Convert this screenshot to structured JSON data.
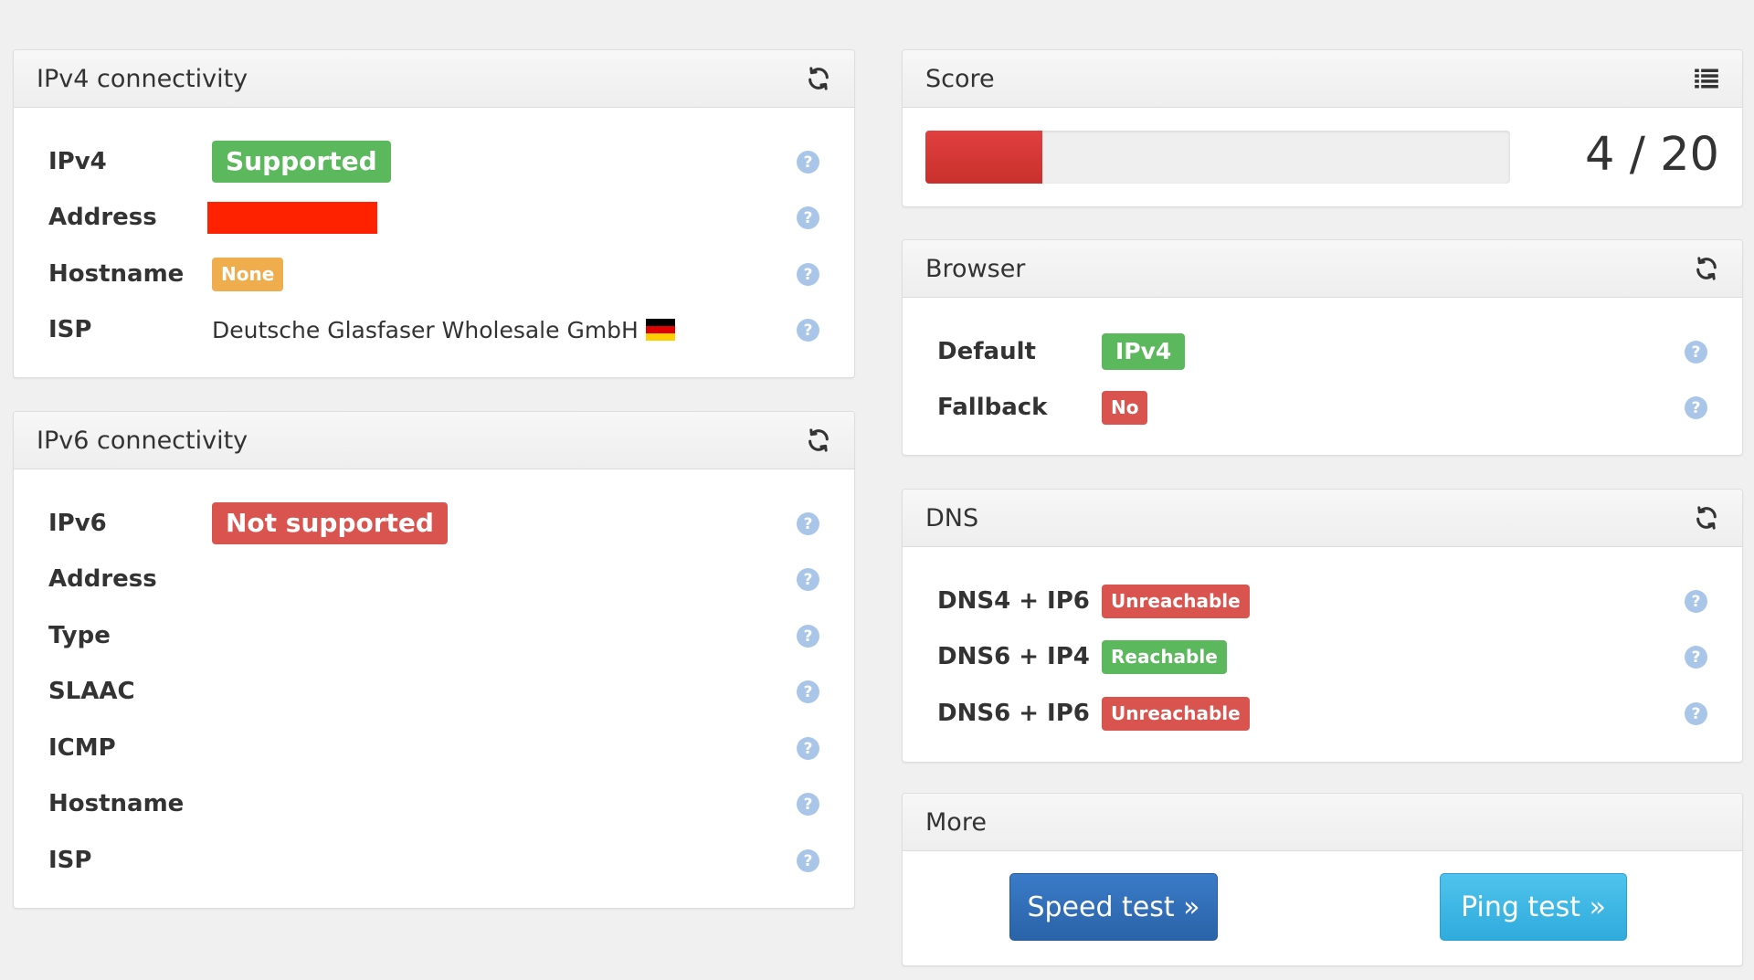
{
  "ipv4": {
    "title": "IPv4 connectivity",
    "rows": [
      {
        "label": "IPv4",
        "value": "Supported"
      },
      {
        "label": "Address",
        "value": ""
      },
      {
        "label": "Hostname",
        "value": "None"
      },
      {
        "label": "ISP",
        "value": "Deutsche Glasfaser Wholesale GmbH"
      }
    ]
  },
  "ipv6": {
    "title": "IPv6 connectivity",
    "rows": [
      {
        "label": "IPv6",
        "value": "Not supported"
      },
      {
        "label": "Address"
      },
      {
        "label": "Type"
      },
      {
        "label": "SLAAC"
      },
      {
        "label": "ICMP"
      },
      {
        "label": "Hostname"
      },
      {
        "label": "ISP"
      }
    ]
  },
  "score": {
    "title": "Score",
    "value": 4,
    "max": 20,
    "text": "4 / 20",
    "bar_color": "#d9534f"
  },
  "browser": {
    "title": "Browser",
    "rows": [
      {
        "label": "Default",
        "value": "IPv4"
      },
      {
        "label": "Fallback",
        "value": "No"
      }
    ]
  },
  "dns": {
    "title": "DNS",
    "rows": [
      {
        "label": "DNS4 + IP6",
        "value": "Unreachable"
      },
      {
        "label": "DNS6 + IP4",
        "value": "Reachable"
      },
      {
        "label": "DNS6 + IP6",
        "value": "Unreachable"
      }
    ]
  },
  "more": {
    "title": "More",
    "speed_test": "Speed test »",
    "ping_test": "Ping test »"
  },
  "help_glyph": "?",
  "icons": {
    "refresh": "refresh-icon",
    "list": "list-icon",
    "help": "help-icon",
    "flag": "flag-de-icon"
  },
  "colors": {
    "success": "#5cb85c",
    "danger": "#d9534f",
    "warning": "#f0ad4e",
    "primary": "#2a63a8",
    "info": "#2fabdd"
  }
}
